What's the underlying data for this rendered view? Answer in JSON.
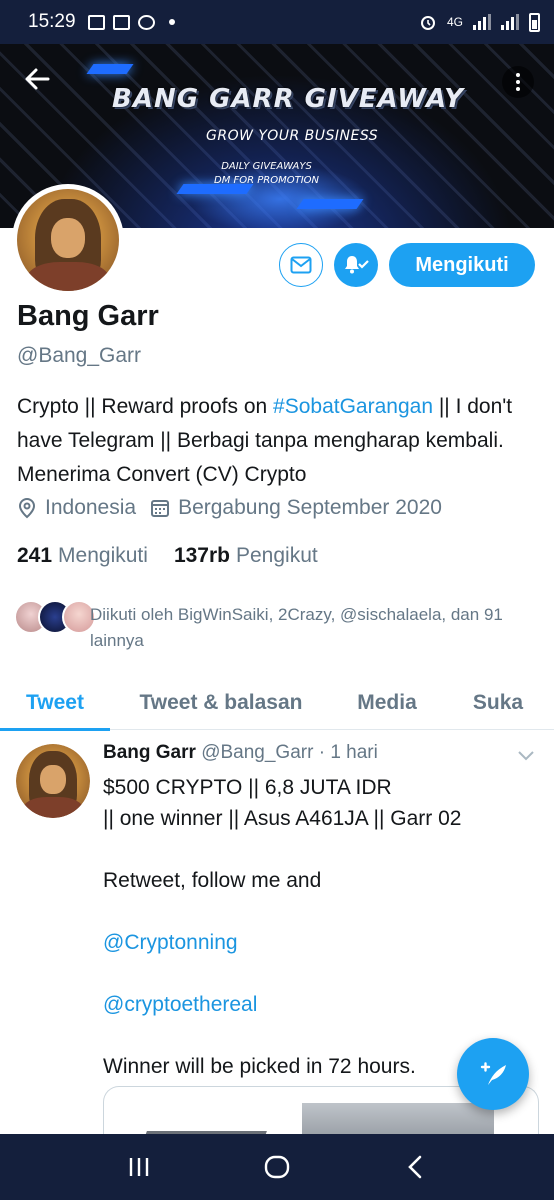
{
  "status_bar": {
    "time": "15:29",
    "network": "4G"
  },
  "banner": {
    "title": "BANG GARR GIVEAWAY",
    "subtitle": "GROW YOUR BUSINESS",
    "line1": "DAILY GIVEAWAYS",
    "line2": "DM FOR PROMOTION"
  },
  "actions": {
    "follow_label": "Mengikuti"
  },
  "profile": {
    "name": "Bang Garr",
    "handle": "@Bang_Garr",
    "bio_part1": "Crypto || Reward proofs on ",
    "bio_hashtag": "#SobatGarangan",
    "bio_part2": " || I don't have Telegram || Berbagi tanpa mengharap kembali. Menerima Convert (CV) Crypto",
    "location": "Indonesia",
    "joined": "Bergabung September 2020",
    "following_count": "241",
    "following_label": "Mengikuti",
    "followers_count": "137rb",
    "followers_label": "Pengikut",
    "followed_by": "Diikuti oleh BigWinSaiki, 2Crazy, @sischalaela, dan 91 lainnya"
  },
  "tabs": [
    {
      "label": "Tweet",
      "active": true
    },
    {
      "label": "Tweet & balasan",
      "active": false
    },
    {
      "label": "Media",
      "active": false
    },
    {
      "label": "Suka",
      "active": false
    }
  ],
  "tweet": {
    "name": "Bang Garr",
    "meta": "@Bang_Garr · 1 hari",
    "line1": "$500 CRYPTO || 6,8 JUTA IDR",
    "line2": "|| one winner || Asus A461JA || Garr 02",
    "line3": "Retweet, follow me and",
    "mention1": "@Cryptonning",
    "mention2": "@cryptoethereal",
    "line4": "Winner will be picked in 72 hours."
  },
  "colors": {
    "accent": "#1da1f2",
    "link": "#1b95e0",
    "secondary_text": "#657786",
    "system_bar": "#141f3c"
  },
  "icons": [
    "back-arrow-icon",
    "more-vertical-icon",
    "mail-icon",
    "bell-check-icon",
    "location-pin-icon",
    "calendar-icon",
    "chevron-down-icon",
    "compose-tweet-icon",
    "recents-icon",
    "home-icon",
    "back-nav-icon"
  ]
}
